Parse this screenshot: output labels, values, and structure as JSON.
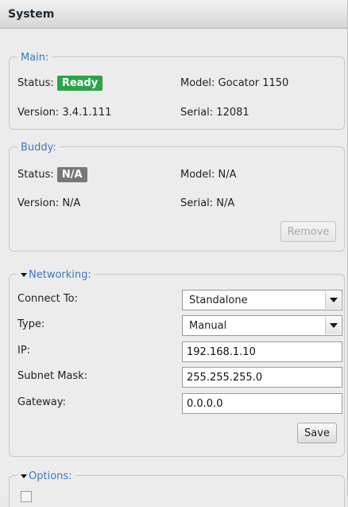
{
  "header": {
    "title": "System"
  },
  "main": {
    "legend": "Main:",
    "status_label": "Status:",
    "status_value": "Ready",
    "model": "Model: Gocator 1150",
    "version": "Version: 3.4.1.111",
    "serial": "Serial: 12081",
    "status_color": "#2aa44a"
  },
  "buddy": {
    "legend": "Buddy:",
    "status_label": "Status:",
    "status_value": "N/A",
    "model": "Model: N/A",
    "version": "Version: N/A",
    "serial": "Serial: N/A",
    "remove_label": "Remove"
  },
  "networking": {
    "legend": "Networking:",
    "connect_to_label": "Connect To:",
    "connect_to_value": "Standalone",
    "type_label": "Type:",
    "type_value": "Manual",
    "ip_label": "IP:",
    "ip_value": "192.168.1.10",
    "subnet_label": "Subnet Mask:",
    "subnet_value": "255.255.255.0",
    "gateway_label": "Gateway:",
    "gateway_value": "0.0.0.0",
    "save_label": "Save"
  },
  "options": {
    "legend": "Options:"
  },
  "colors": {
    "accent": "#3a78c6",
    "ready": "#2aa44a",
    "na": "#777777"
  }
}
